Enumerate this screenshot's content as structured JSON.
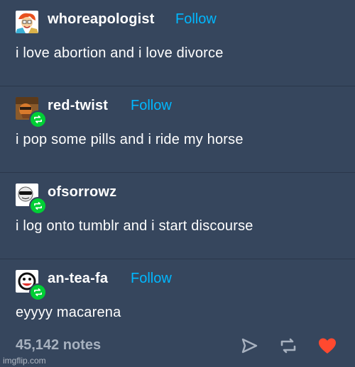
{
  "posts": [
    {
      "username": "whoreapologist",
      "follow": "Follow",
      "text": "i love abortion and i love divorce"
    },
    {
      "username": "red-twist",
      "follow": "Follow",
      "text": "i pop some pills and i ride my horse"
    },
    {
      "username": "ofsorrowz",
      "follow": "",
      "text": "i log onto tumblr and i start discourse"
    },
    {
      "username": "an-tea-fa",
      "follow": "Follow",
      "text": "eyyyy macarena"
    }
  ],
  "footer": {
    "notes": "45,142 notes",
    "icons": [
      "share-icon",
      "reblog-icon",
      "like-heart-icon"
    ]
  },
  "watermark": "imgflip.com",
  "colors": {
    "background": "#36465d",
    "follow": "#00b8ff",
    "reblog_badge": "#00cf35",
    "heart": "#ff492f",
    "notes": "#a7b1bf"
  }
}
